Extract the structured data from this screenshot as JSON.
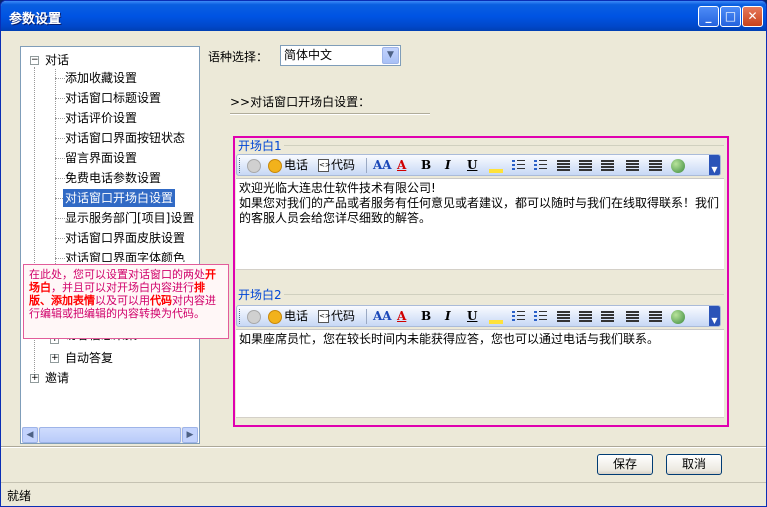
{
  "window": {
    "title": "参数设置"
  },
  "tree": {
    "root_items": [
      {
        "label": "对话",
        "expander": "⊟"
      },
      {
        "label": "邀请",
        "expander": "⊞"
      }
    ],
    "children": [
      "添加收藏设置",
      "对话窗口标题设置",
      "对话评价设置",
      "对话窗口界面按钮状态",
      "留言界面设置",
      "免费电话参数设置",
      "对话窗口开场白设置",
      "显示服务部门[项目]设置",
      "对话窗口界面皮肤设置",
      "对话窗口界面字体颜色"
    ],
    "partial_children": [
      {
        "label": "访客信息采集",
        "expander": "⊞"
      },
      {
        "label": "自动答复",
        "expander": "⊞"
      }
    ],
    "selected_index": 6
  },
  "tooltip": {
    "p1": "在此处，您可以设置对话窗口的两处",
    "b1": "开场白",
    "p2": "，并且可以对开场白内容进行",
    "b2": "排版、添加表情",
    "p3": "以及可以用",
    "b3": "代码",
    "p4": "对内容进行编辑或把编辑的内容转换为代码。"
  },
  "language": {
    "label": "语种选择：",
    "selected": "简体中文"
  },
  "section": {
    "title": ">>对话窗口开场白设置："
  },
  "toolbar": {
    "phone_label": "电话",
    "code_label": "代码"
  },
  "greeting1": {
    "label": "开场白1",
    "line1": "欢迎光临大连忠仕软件技术有限公司!",
    "line2": "如果您对我们的产品或者服务有任何意见或者建议，都可以随时与我们在线取得联系！我们的客服人员会给您详尽细致的解答。"
  },
  "greeting2": {
    "label": "开场白2",
    "line1": "如果座席员忙，您在较长时间内未能获得应答，您也可以通过电话与我们联系。"
  },
  "buttons": {
    "save": "保存",
    "cancel": "取消"
  },
  "status": {
    "text": "就绪"
  }
}
